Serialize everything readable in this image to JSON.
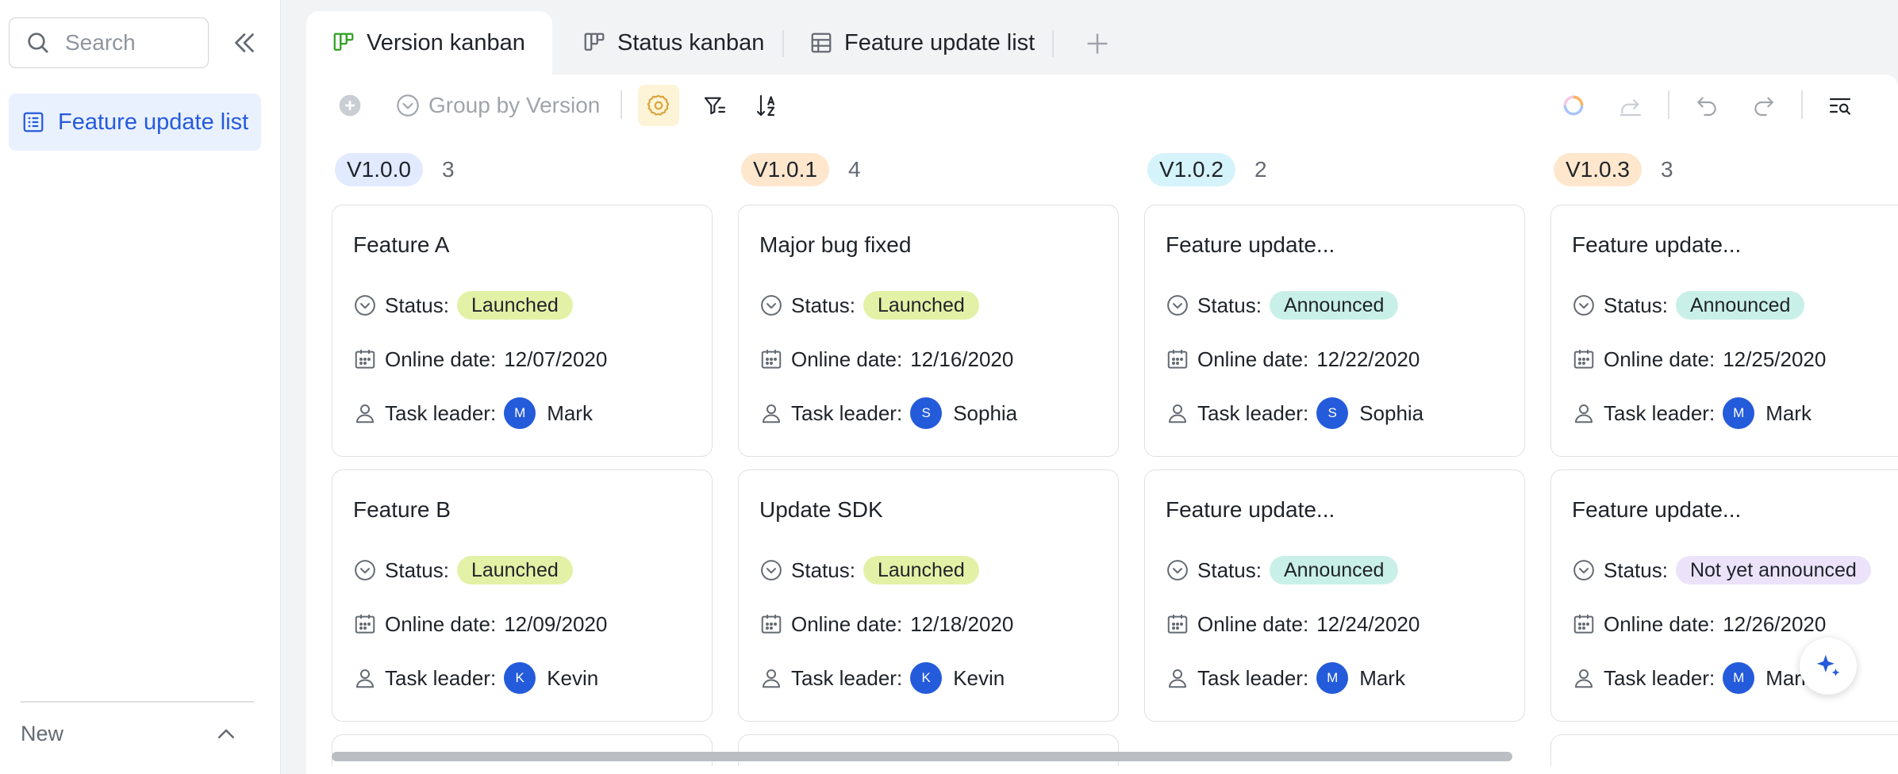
{
  "sidebar": {
    "search_placeholder": "Search",
    "items": [
      {
        "label": "Feature update list",
        "icon": "list-icon"
      }
    ],
    "new_label": "New"
  },
  "tabs": [
    {
      "label": "Version kanban",
      "icon": "kanban-icon",
      "active": true
    },
    {
      "label": "Status kanban",
      "icon": "kanban-icon",
      "active": false
    },
    {
      "label": "Feature update list",
      "icon": "table-icon",
      "active": false
    }
  ],
  "toolbar": {
    "group_label": "Group by Version"
  },
  "colors": {
    "accent": "#245bdb",
    "launched": "#e3f1a6",
    "announced": "#c9f0e8",
    "not_announced": "#ece3fb",
    "v100": "#e1eaff",
    "v101": "#fee7cd",
    "v102": "#d5f3fa",
    "v103": "#fee7cd"
  },
  "columns": [
    {
      "version": "V1.0.0",
      "count": "3",
      "cards": [
        {
          "title": "Feature A",
          "status_label": "Status:",
          "status": "Launched",
          "date_label": "Online date:",
          "date": "12/07/2020",
          "leader_label": "Task leader:",
          "leader_initial": "M",
          "leader": "Mark"
        },
        {
          "title": "Feature B",
          "status_label": "Status:",
          "status": "Launched",
          "date_label": "Online date:",
          "date": "12/09/2020",
          "leader_label": "Task leader:",
          "leader_initial": "K",
          "leader": "Kevin"
        }
      ]
    },
    {
      "version": "V1.0.1",
      "count": "4",
      "cards": [
        {
          "title": "Major bug fixed",
          "status_label": "Status:",
          "status": "Launched",
          "date_label": "Online date:",
          "date": "12/16/2020",
          "leader_label": "Task leader:",
          "leader_initial": "S",
          "leader": "Sophia"
        },
        {
          "title": "Update SDK",
          "status_label": "Status:",
          "status": "Launched",
          "date_label": "Online date:",
          "date": "12/18/2020",
          "leader_label": "Task leader:",
          "leader_initial": "K",
          "leader": "Kevin"
        }
      ]
    },
    {
      "version": "V1.0.2",
      "count": "2",
      "cards": [
        {
          "title": "Feature update...",
          "status_label": "Status:",
          "status": "Announced",
          "date_label": "Online date:",
          "date": "12/22/2020",
          "leader_label": "Task leader:",
          "leader_initial": "S",
          "leader": "Sophia"
        },
        {
          "title": "Feature update...",
          "status_label": "Status:",
          "status": "Announced",
          "date_label": "Online date:",
          "date": "12/24/2020",
          "leader_label": "Task leader:",
          "leader_initial": "M",
          "leader": "Mark"
        }
      ]
    },
    {
      "version": "V1.0.3",
      "count": "3",
      "cards": [
        {
          "title": "Feature update...",
          "status_label": "Status:",
          "status": "Announced",
          "date_label": "Online date:",
          "date": "12/25/2020",
          "leader_label": "Task leader:",
          "leader_initial": "M",
          "leader": "Mark"
        },
        {
          "title": "Feature update...",
          "status_label": "Status:",
          "status": "Not yet announced",
          "date_label": "Online date:",
          "date": "12/26/2020",
          "leader_label": "Task leader:",
          "leader_initial": "M",
          "leader": "Mark"
        }
      ]
    }
  ]
}
